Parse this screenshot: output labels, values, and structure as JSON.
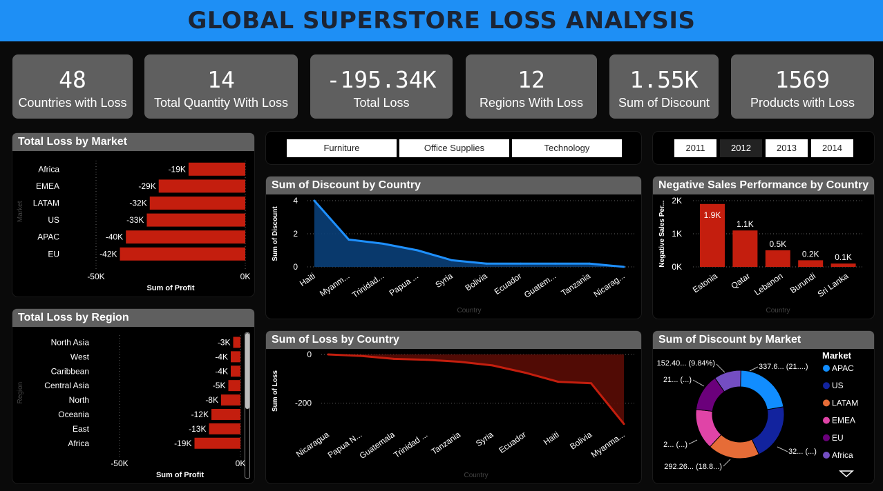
{
  "title": "GLOBAL SUPERSTORE LOSS ANALYSIS",
  "kpis": [
    {
      "value": "48",
      "label": "Countries with Loss"
    },
    {
      "value": "14",
      "label": "Total Quantity With Loss"
    },
    {
      "value": "-195.34K",
      "label": "Total Loss"
    },
    {
      "value": "12",
      "label": "Regions With Loss"
    },
    {
      "value": "1.55K",
      "label": "Sum of Discount"
    },
    {
      "value": "1569",
      "label": "Products with Loss"
    }
  ],
  "category_slicer": [
    "Furniture",
    "Office Supplies",
    "Technology"
  ],
  "year_slicer": {
    "options": [
      "2011",
      "2012",
      "2013",
      "2014"
    ],
    "selected": "2012"
  },
  "colors": {
    "accent": "#1e8ff5",
    "bar": "#c41e0e",
    "panel_header": "#5f5f5f",
    "line_blue": "#1e90ff",
    "line_red": "#c41e0e"
  },
  "chart_data": [
    {
      "id": "market",
      "type": "bar",
      "orientation": "horizontal",
      "title": "Total Loss by Market",
      "xlabel": "Sum of Profit",
      "ylabel": "Market",
      "categories": [
        "Africa",
        "EMEA",
        "LATAM",
        "US",
        "APAC",
        "EU"
      ],
      "values": [
        -19000,
        -29000,
        -32000,
        -33000,
        -40000,
        -42000
      ],
      "data_labels": [
        "-19K",
        "-29K",
        "-32K",
        "-33K",
        "-40K",
        "-42K"
      ],
      "xlim": [
        -50000,
        0
      ],
      "ticks": [
        "-50K",
        "0K"
      ]
    },
    {
      "id": "region",
      "type": "bar",
      "orientation": "horizontal",
      "title": "Total Loss by Region",
      "xlabel": "Sum of Profit",
      "ylabel": "Region",
      "categories": [
        "North Asia",
        "West",
        "Caribbean",
        "Central Asia",
        "North",
        "Oceania",
        "East",
        "Africa"
      ],
      "values": [
        -3000,
        -4000,
        -4000,
        -5000,
        -8000,
        -12000,
        -13000,
        -19000
      ],
      "data_labels": [
        "-3K",
        "-4K",
        "-4K",
        "-5K",
        "-8K",
        "-12K",
        "-13K",
        "-19K"
      ],
      "xlim": [
        -50000,
        0
      ],
      "ticks": [
        "-50K",
        "0K"
      ]
    },
    {
      "id": "discount_country",
      "type": "area",
      "title": "Sum of Discount by Country",
      "xlabel": "Country",
      "ylabel": "Sum of Discount",
      "categories": [
        "Haiti",
        "Myanm...",
        "Trinidad...",
        "Papua ...",
        "Syria",
        "Bolivia",
        "Ecuador",
        "Guatem...",
        "Tanzania",
        "Nicarag..."
      ],
      "values": [
        4,
        1.65,
        1.4,
        1.0,
        0.4,
        0.2,
        0.2,
        0.2,
        0.2,
        0.0
      ],
      "ylim": [
        0,
        4
      ],
      "yticks": [
        0,
        2,
        4
      ]
    },
    {
      "id": "negative_sales",
      "type": "bar",
      "title": "Negative Sales Performance by Country",
      "xlabel": "Country",
      "ylabel": "Negative Sales Per...",
      "categories": [
        "Estonia",
        "Qatar",
        "Lebanon",
        "Burundi",
        "Sri Lanka"
      ],
      "values": [
        1900,
        1100,
        500,
        200,
        100
      ],
      "data_labels": [
        "1.9K",
        "1.1K",
        "0.5K",
        "0.2K",
        "0.1K"
      ],
      "ylim": [
        0,
        2000
      ],
      "yticks": [
        "0K",
        "1K",
        "2K"
      ]
    },
    {
      "id": "loss_country",
      "type": "area",
      "title": "Sum of Loss by Country",
      "xlabel": "Country",
      "ylabel": "Sum of Loss",
      "categories": [
        "Nicaragua",
        "Papua N...",
        "Guatemala",
        "Trinidad ...",
        "Tanzania",
        "Syria",
        "Ecuador",
        "Haiti",
        "Bolivia",
        "Myanma..."
      ],
      "values": [
        0,
        -6,
        -18,
        -22,
        -30,
        -45,
        -75,
        -112,
        -118,
        -285
      ],
      "ylim": [
        -300,
        0
      ],
      "yticks": [
        0,
        -200
      ]
    },
    {
      "id": "discount_market",
      "type": "pie",
      "variant": "donut",
      "title": "Sum of Discount by Market",
      "legend_title": "Market",
      "legend_position": "right",
      "categories": [
        "APAC",
        "US",
        "LATAM",
        "EMEA",
        "EU",
        "Africa"
      ],
      "values": [
        337.6,
        320,
        292.26,
        230,
        210,
        152.4
      ],
      "colors": [
        "#118dff",
        "#12239e",
        "#e66c37",
        "#e044a7",
        "#6b007b",
        "#744ec2"
      ],
      "data_labels": [
        "337.6... (21....)",
        "32... (...)",
        "292.26... (18.8...)",
        "2... (...)",
        "21... (...)",
        "152.40... (9.84%)"
      ]
    }
  ]
}
